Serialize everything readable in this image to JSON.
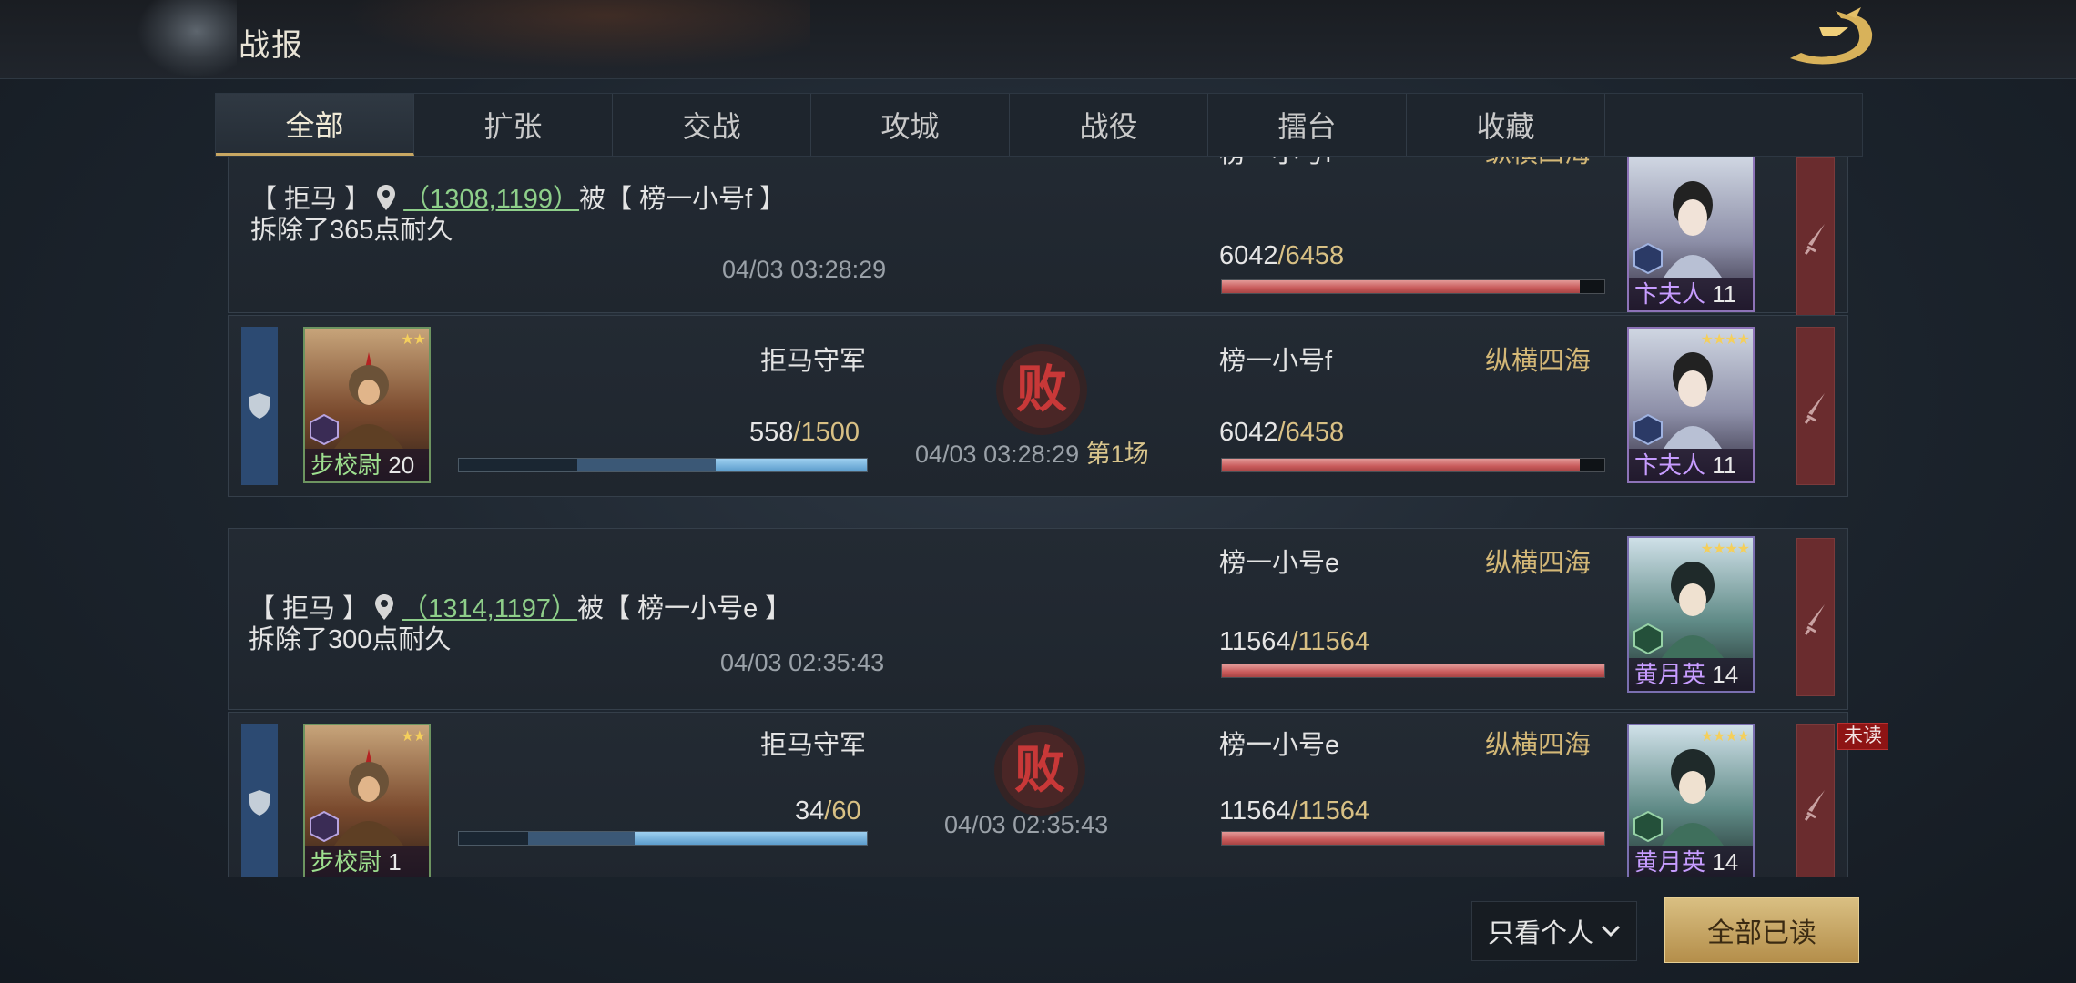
{
  "header": {
    "title": "战报",
    "logo": "dragon-emblem"
  },
  "tabs": [
    "全部",
    "扩张",
    "交战",
    "攻城",
    "战役",
    "擂台",
    "收藏"
  ],
  "active_tab": "全部",
  "reports": [
    {
      "summary": {
        "prefix": "【 拒马 】",
        "coord": "（1308,1199）",
        "middle": "被【 榜一小号f 】",
        "line2": "拆除了365点耐久"
      },
      "time": "04/03 03:28:29",
      "right": {
        "name": "榜一小号f",
        "guild": "纵横四海",
        "hp": "6042",
        "hp_max": "/6458",
        "hp_ratio": 0.936,
        "hero_name": "卞夫人",
        "hero_level": "11",
        "faction": "魏"
      }
    },
    {
      "left": {
        "name": "拒马守军",
        "hp": "558",
        "hp_max": "/1500",
        "hero_name": "步校尉",
        "hero_level": "20",
        "faction": "群"
      },
      "result_icon": "defeat-seal",
      "time": "04/03 03:28:29",
      "stage": "第1场",
      "right": {
        "name": "榜一小号f",
        "guild": "纵横四海",
        "hp": "6042",
        "hp_max": "/6458",
        "hp_ratio": 0.936,
        "hero_name": "卞夫人",
        "hero_level": "11",
        "faction": "魏"
      }
    },
    {
      "summary": {
        "prefix": "【 拒马 】",
        "coord": "（1314,1197）",
        "middle": "被【 榜一小号e 】",
        "line2": "拆除了300点耐久"
      },
      "time": "04/03 02:35:43",
      "right": {
        "name": "榜一小号e",
        "guild": "纵横四海",
        "hp": "11564",
        "hp_max": "/11564",
        "hp_ratio": 1.0,
        "hero_name": "黄月英",
        "hero_level": "14",
        "faction": "蜀"
      }
    },
    {
      "left": {
        "name": "拒马守军",
        "hp": "34",
        "hp_max": "/60",
        "hero_name": "步校尉",
        "hero_level": "1",
        "faction": "群"
      },
      "result_icon": "defeat-seal",
      "time": "04/03 02:35:43",
      "right": {
        "name": "榜一小号e",
        "guild": "纵横四海",
        "hp": "11564",
        "hp_max": "/11564",
        "hp_ratio": 1.0,
        "hero_name": "黄月英",
        "hero_level": "14",
        "faction": "蜀"
      },
      "badge": "未读"
    }
  ],
  "defeat_char": "败",
  "footer": {
    "filter_label": "只看个人",
    "read_all_label": "全部已读"
  }
}
